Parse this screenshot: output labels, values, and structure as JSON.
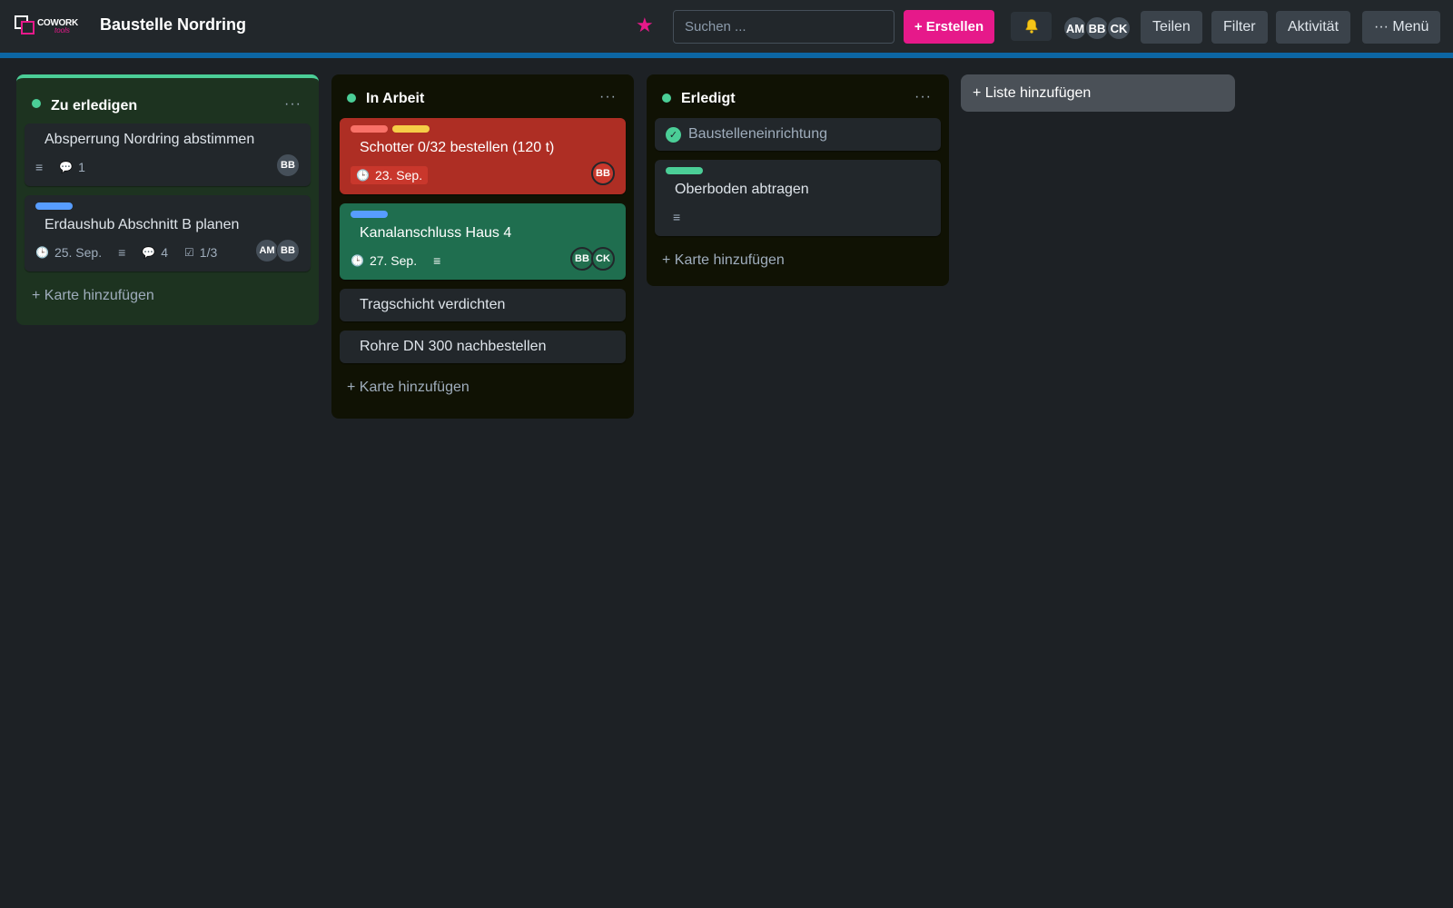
{
  "app": {
    "logo_text": "COWORK",
    "logo_sub": "tools",
    "board_title": "Baustelle Nordring",
    "search_placeholder": "Suchen ...",
    "create_label": "+ Erstellen",
    "members": [
      "AM",
      "BB",
      "CK"
    ],
    "buttons": {
      "share": "Teilen",
      "filter": "Filter",
      "activity": "Aktivität",
      "menu": "··· Menü"
    },
    "add_list": "+ Liste hinzufügen",
    "add_card": "+ Karte hinzufügen",
    "colors": {
      "accent": "#e6198a",
      "stripe": "#0c66a4",
      "done": "#4bce97"
    }
  },
  "lists": [
    {
      "title": "Zu erledigen",
      "cards": [
        {
          "title": "Absperrung Nordring abstimmen",
          "comments": "1",
          "members": [
            "BB"
          ]
        },
        {
          "title": "Erdaushub Abschnitt B planen",
          "due": "25. Sep.",
          "comments": "4",
          "checklist": "1/3",
          "members": [
            "AM",
            "BB"
          ]
        }
      ]
    },
    {
      "title": "In Arbeit",
      "cards": [
        {
          "title": "Schotter 0/32 bestellen (120 t)",
          "due": "23. Sep.",
          "members": [
            "BB"
          ]
        },
        {
          "title": "Kanalanschluss Haus 4",
          "due": "27. Sep.",
          "members": [
            "BB",
            "CK"
          ]
        },
        {
          "title": "Tragschicht verdichten"
        },
        {
          "title": "Rohre DN 300 nachbestellen"
        }
      ]
    },
    {
      "title": "Erledigt",
      "cards": [
        {
          "title": "Baustelleneinrichtung"
        },
        {
          "title": "Oberboden abtragen"
        }
      ]
    }
  ]
}
